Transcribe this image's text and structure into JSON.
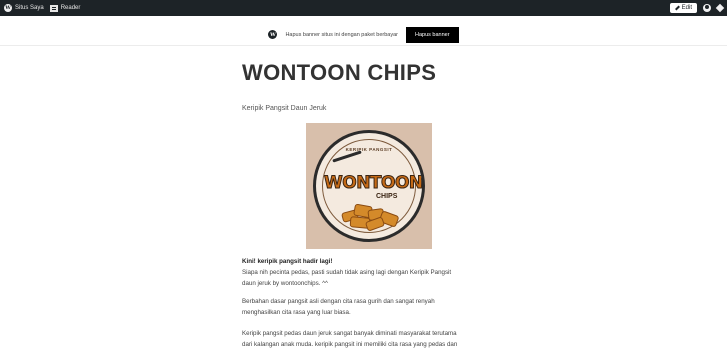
{
  "adminbar": {
    "site_label": "Situs Saya",
    "reader_label": "Reader",
    "edit_label": "Edit"
  },
  "banner": {
    "text": "Hapus banner situs ini dengan paket berbayar",
    "button_label": "Hapus banner"
  },
  "page": {
    "title": "WONTOON CHIPS",
    "subtitle": "Keripik Pangsit Daun Jeruk"
  },
  "logo": {
    "arc_text": "KERIPIK PANGSIT",
    "word": "WONTOON",
    "sub": "CHIPS"
  },
  "body": {
    "p1_heading": "Kini! keripik pangsit hadir lagi!",
    "p1_line1": "Siapa nih pecinta pedas, pasti sudah tidak asing lagi dengan Keripik Pangsit",
    "p1_line2": "daun jeruk by wontoonchips. ^^",
    "p2_line1": "Berbahan dasar pangsit asli dengan cita rasa gurih dan sangat renyah",
    "p2_line2": "menghasilkan cita rasa yang luar biasa.",
    "p3_line1": "Keripik pangsit pedas daun jeruk sangat banyak diminati masyarakat terutama",
    "p3_line2": "dari kalangan anak muda. keripik pangsit ini memiliki cita rasa yang pedas dan"
  },
  "colors": {
    "adminbar_bg": "#1d2327",
    "button_bg": "#000000",
    "logo_orange": "#c56a16",
    "image_bg": "#d8bfab"
  }
}
